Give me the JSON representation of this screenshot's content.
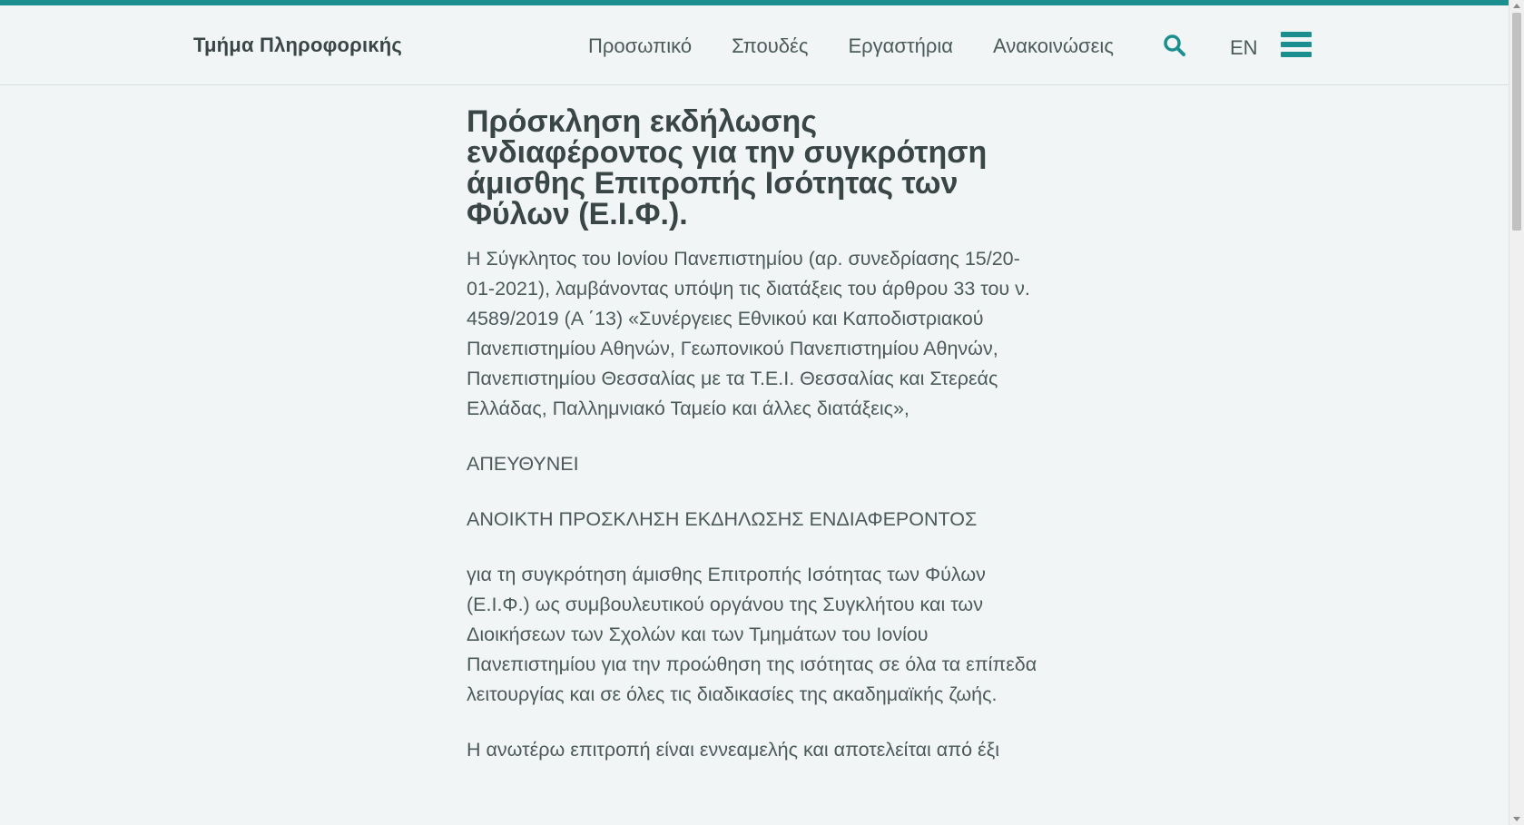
{
  "header": {
    "site_title": "Τμήμα Πληροφορικής",
    "nav": [
      {
        "label": "Προσωπικό"
      },
      {
        "label": "Σπουδές"
      },
      {
        "label": "Εργαστήρια"
      },
      {
        "label": "Ανακοινώσεις"
      }
    ],
    "search_icon": "search-icon",
    "lang_label": "EN",
    "menu_icon": "hamburger-menu-icon"
  },
  "article": {
    "title": "Πρόσκληση εκδήλωσης ενδιαφέροντος για την συγκρότηση άμισθης Επιτροπής Ισότητας των Φύλων (Ε.Ι.Φ.).",
    "paragraphs": [
      "Η Σύγκλητος του Ιονίου Πανεπιστημίου (αρ. συνεδρίασης 15/20-01-2021), λαμβάνοντας υπόψη τις διατάξεις του άρθρου 33 του ν. 4589/2019 (Α ΄13) «Συνέργειες Εθνικού και Καποδιστριακού Πανεπιστημίου Αθηνών, Γεωπονικού Πανεπιστημίου Αθηνών, Πανεπιστημίου Θεσσαλίας με τα Τ.Ε.Ι. Θεσσαλίας και Στερεάς Ελλάδας, Παλλημνιακό Ταμείο και άλλες διατάξεις»,",
      "ΑΠΕΥΘΥΝΕΙ",
      "ΑΝΟΙΚΤΗ ΠΡΟΣΚΛΗΣΗ ΕΚΔΗΛΩΣΗΣ ΕΝΔΙΑΦΕΡΟΝΤΟΣ",
      "για τη συγκρότηση άμισθης Επιτροπής Ισότητας των Φύλων (Ε.Ι.Φ.) ως συμβουλευτικού οργάνου της Συγκλήτου και των Διοικήσεων των Σχολών και των Τμημάτων του Ιονίου Πανεπιστημίου για την προώθηση της ισότητας σε όλα τα επίπεδα λειτουργίας και σε όλες τις διαδικασίες της ακαδημαϊκής ζωής.",
      "Η ανωτέρω επιτροπή είναι εννεαμελής και αποτελείται από έξι"
    ]
  },
  "colors": {
    "accent": "#1b8f8f",
    "background": "#f1f5f5",
    "text": "#4c5a5a",
    "heading": "#3a4646"
  }
}
